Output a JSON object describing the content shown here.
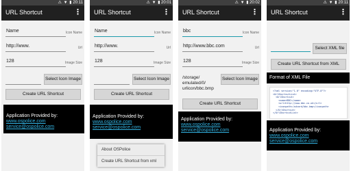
{
  "app_title": "URL Shortcut",
  "status": {
    "icons": "⚠ ▼ ▮",
    "times": [
      "20:11",
      "20:01",
      "20:02",
      "20:11"
    ]
  },
  "hints": {
    "icon_name": "Icon Name",
    "url": "Url",
    "image_size": "Image Size"
  },
  "screens": [
    {
      "name_value": "Name",
      "url_value": "http://www.",
      "size_value": "128"
    },
    {
      "name_value": "Name",
      "url_value": "http://www.",
      "size_value": "128"
    },
    {
      "name_value": "bbc",
      "url_value": "http://www.bbc.com",
      "size_value": "128",
      "path_lines": [
        "/storage/",
        "emulated/0/",
        "urlicon/bbc.bmp"
      ]
    },
    {
      "xml_input_value": ""
    }
  ],
  "buttons": {
    "select_icon_image": "Select Icon Image",
    "create_url_shortcut": "Create URL Shortcut",
    "select_xml_file": "Select XML file",
    "create_from_xml": "Create URL Shortcut from XML"
  },
  "credits": {
    "label": "Application Provided by:",
    "website": "www.ospolice.com",
    "email": "service@ospolice.com"
  },
  "xml_format": {
    "title": "Format of XML File",
    "code_lines": [
      "<?xml version=\"1.0\" encoding=\"UTF-8\"?>",
      "<UrlShortcutList>",
      "  <UrlShortcut>",
      "    <name>BBC</name>",
      "    <url>http://www.bbc.co.uk</url>",
      "    <iconpath>/sdcard/bbc.bmp</iconpath>",
      "  </UrlShortcut>",
      "</UrlShortcutList>"
    ]
  },
  "menu": {
    "items": [
      "About OSPolice",
      "Create URL Shortcut from xml"
    ]
  },
  "colors": {
    "accent": "#1b9aaa",
    "link": "#33b5e5",
    "actionbar": "#202020"
  }
}
